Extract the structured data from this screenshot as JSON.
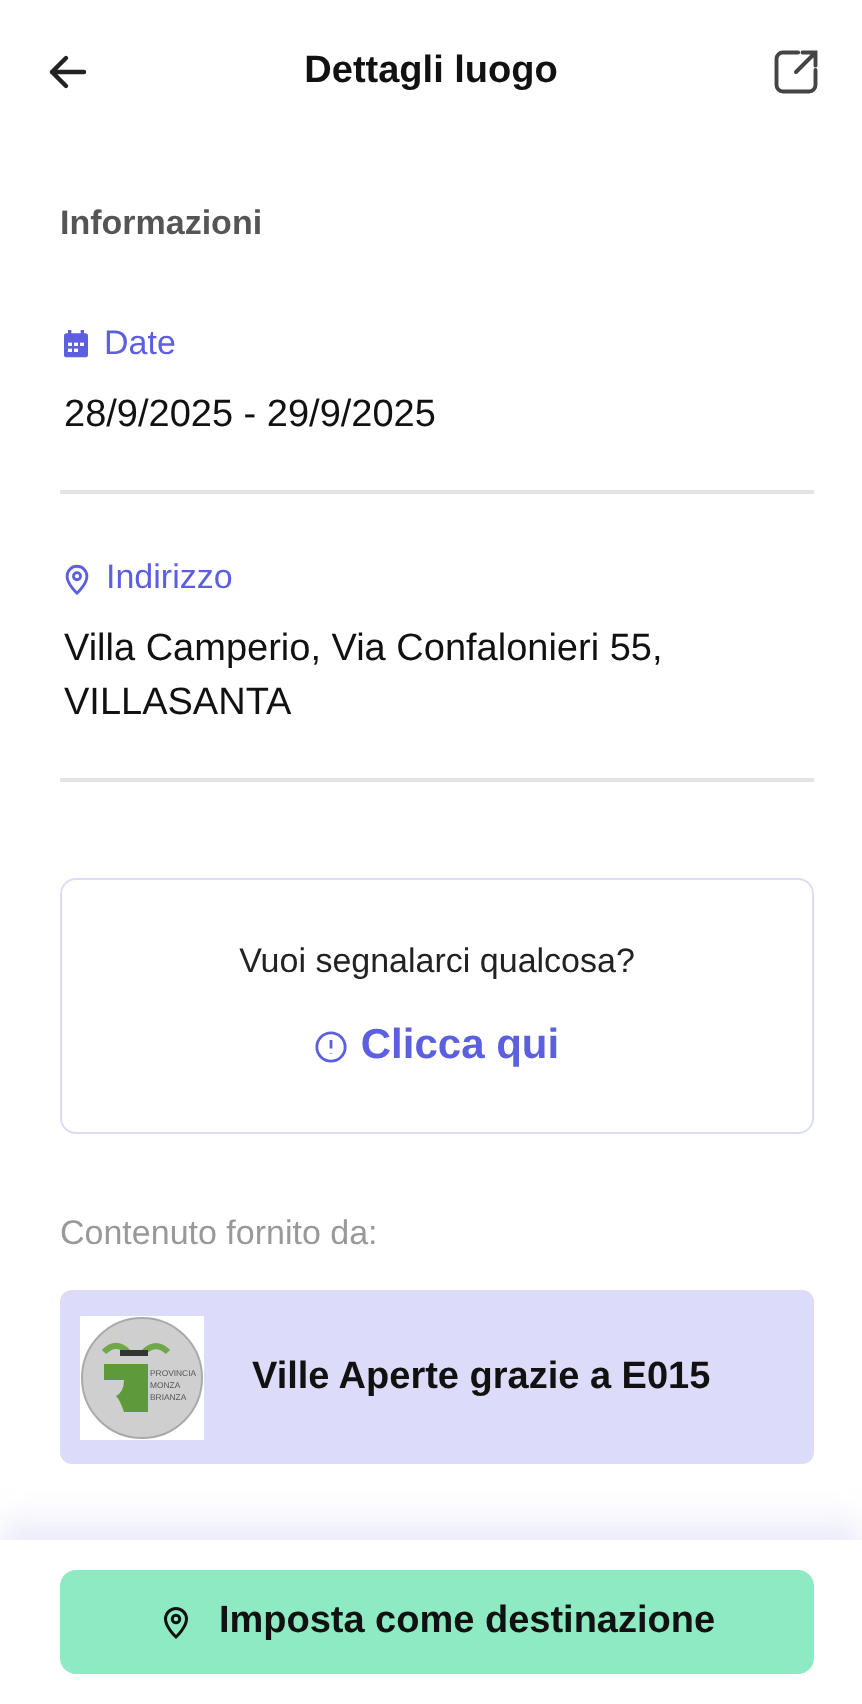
{
  "header": {
    "title": "Dettagli luogo"
  },
  "section_title": "Informazioni",
  "fields": [
    {
      "kind": "date",
      "label": "Date",
      "value": "28/9/2025 - 29/9/2025"
    },
    {
      "kind": "address",
      "label": "Indirizzo",
      "value": "Villa Camperio, Via Confalonieri 55, VILLASANTA"
    }
  ],
  "report_card": {
    "question": "Vuoi segnalarci qualcosa?",
    "link": "Clicca qui"
  },
  "provider": {
    "caption": "Contenuto fornito da:",
    "logo_lines": [
      "PROVINCIA",
      "MONZA",
      "BRIANZA"
    ],
    "name": "Ville Aperte grazie a E015"
  },
  "primary_button": "Imposta come destinazione"
}
